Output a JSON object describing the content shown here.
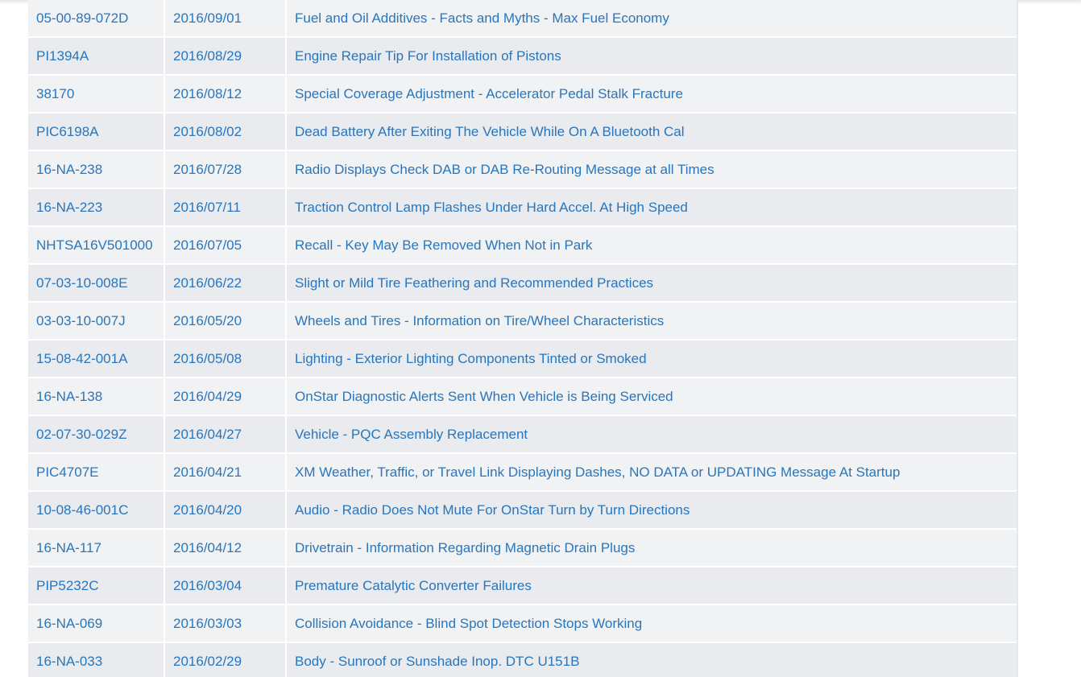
{
  "bulletins": [
    {
      "id": "05-00-89-072D",
      "date": "2016/09/01",
      "title": "Fuel and Oil Additives - Facts and Myths - Max Fuel Economy"
    },
    {
      "id": "PI1394A",
      "date": "2016/08/29",
      "title": "Engine Repair Tip For Installation of Pistons"
    },
    {
      "id": "38170",
      "date": "2016/08/12",
      "title": "Special Coverage Adjustment - Accelerator Pedal Stalk Fracture"
    },
    {
      "id": "PIC6198A",
      "date": "2016/08/02",
      "title": "Dead Battery After Exiting The Vehicle While On A Bluetooth Cal"
    },
    {
      "id": "16-NA-238",
      "date": "2016/07/28",
      "title": "Radio Displays Check DAB or DAB Re-Routing Message at all Times"
    },
    {
      "id": "16-NA-223",
      "date": "2016/07/11",
      "title": "Traction Control Lamp Flashes Under Hard Accel. At High Speed"
    },
    {
      "id": "NHTSA16V501000",
      "date": "2016/07/05",
      "title": "Recall - Key May Be Removed When Not in Park"
    },
    {
      "id": "07-03-10-008E",
      "date": "2016/06/22",
      "title": "Slight or Mild Tire Feathering and Recommended Practices"
    },
    {
      "id": "03-03-10-007J",
      "date": "2016/05/20",
      "title": "Wheels and Tires - Information on Tire/Wheel Characteristics"
    },
    {
      "id": "15-08-42-001A",
      "date": "2016/05/08",
      "title": "Lighting - Exterior Lighting Components Tinted or Smoked"
    },
    {
      "id": "16-NA-138",
      "date": "2016/04/29",
      "title": "OnStar Diagnostic Alerts Sent When Vehicle is Being Serviced"
    },
    {
      "id": "02-07-30-029Z",
      "date": "2016/04/27",
      "title": "Vehicle - PQC Assembly Replacement"
    },
    {
      "id": "PIC4707E",
      "date": "2016/04/21",
      "title": "XM Weather, Traffic, or Travel Link Displaying Dashes, NO DATA or UPDATING Message At Startup"
    },
    {
      "id": "10-08-46-001C",
      "date": "2016/04/20",
      "title": "Audio - Radio Does Not Mute For OnStar Turn by Turn Directions"
    },
    {
      "id": "16-NA-117",
      "date": "2016/04/12",
      "title": "Drivetrain - Information Regarding Magnetic Drain Plugs"
    },
    {
      "id": "PIP5232C",
      "date": "2016/03/04",
      "title": "Premature Catalytic Converter Failures"
    },
    {
      "id": "16-NA-069",
      "date": "2016/03/03",
      "title": "Collision Avoidance - Blind Spot Detection Stops Working"
    },
    {
      "id": "16-NA-033",
      "date": "2016/02/29",
      "title": "Body - Sunroof or Sunshade Inop. DTC U151B"
    }
  ],
  "colors": {
    "link": "#2876bd",
    "row_odd": "#f1f2f4",
    "row_even": "#e9ebee"
  }
}
